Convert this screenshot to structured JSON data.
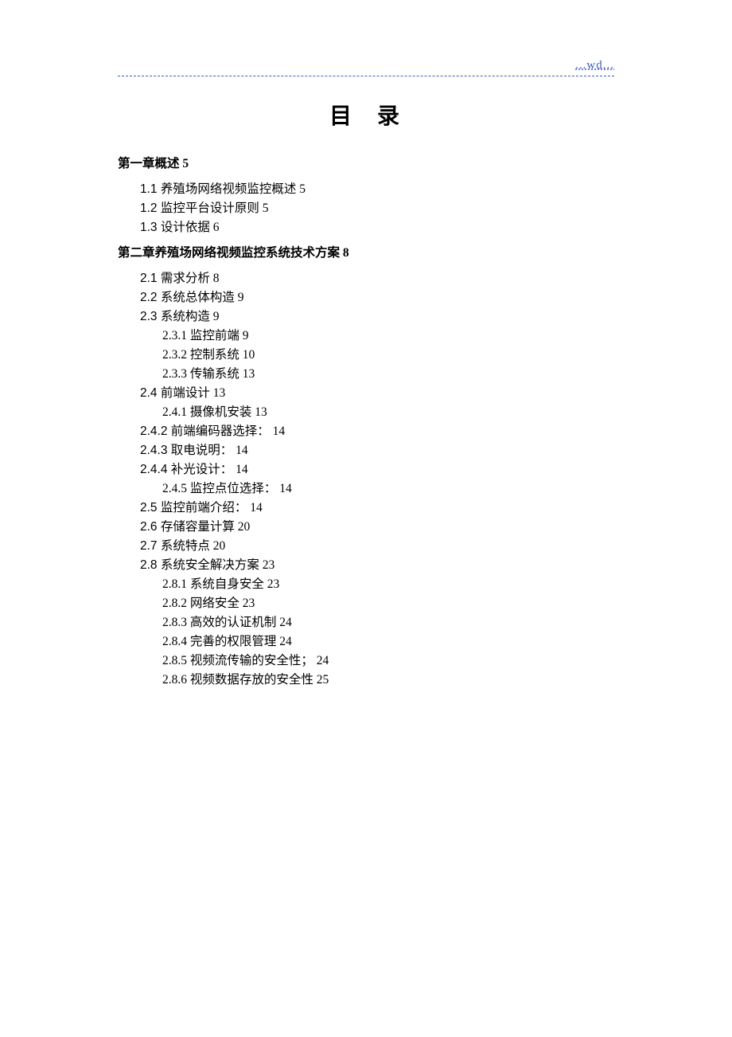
{
  "header": "...wd...",
  "title_part1": "目",
  "title_part2": "录",
  "toc": [
    {
      "level": 1,
      "text": "第一章概述",
      "page": "5"
    },
    {
      "level": 2,
      "text": "1.1 养殖场网络视频监控概述",
      "page": "5"
    },
    {
      "level": 2,
      "text": "1.2 监控平台设计原则",
      "page": "5"
    },
    {
      "level": 2,
      "text": "1.3 设计依据",
      "page": "6"
    },
    {
      "level": 1,
      "text": "第二章养殖场网络视频监控系统技术方案",
      "page": "8"
    },
    {
      "level": 2,
      "text": "2.1 需求分析",
      "page": "8"
    },
    {
      "level": 2,
      "text": "2.2 系统总体构造",
      "page": "9"
    },
    {
      "level": 2,
      "text": "2.3 系统构造",
      "page": "9"
    },
    {
      "level": 3,
      "text": "2.3.1 监控前端",
      "page": "9"
    },
    {
      "level": 3,
      "text": "2.3.2 控制系统",
      "page": "10"
    },
    {
      "level": 3,
      "text": "2.3.3 传输系统",
      "page": "13"
    },
    {
      "level": 2,
      "text": "2.4 前端设计",
      "page": "13"
    },
    {
      "level": 3,
      "text": "2.4.1 摄像机安装",
      "page": "13"
    },
    {
      "level": "2-alt",
      "text": "2.4.2 前端编码器选择：",
      "page": "14"
    },
    {
      "level": "2-alt",
      "text": "2.4.3 取电说明：",
      "page": "14"
    },
    {
      "level": "2-alt",
      "text": "2.4.4 补光设计：",
      "page": "14"
    },
    {
      "level": 3,
      "text": "2.4.5 监控点位选择：",
      "page": "14"
    },
    {
      "level": 2,
      "text": "2.5 监控前端介绍：",
      "page": "14"
    },
    {
      "level": 2,
      "text": "2.6 存储容量计算",
      "page": "20"
    },
    {
      "level": 2,
      "text": "2.7 系统特点",
      "page": "20"
    },
    {
      "level": 2,
      "text": "2.8 系统安全解决方案",
      "page": "23"
    },
    {
      "level": 3,
      "text": "2.8.1 系统自身安全",
      "page": "23"
    },
    {
      "level": 3,
      "text": "2.8.2 网络安全",
      "page": "23"
    },
    {
      "level": 3,
      "text": "2.8.3 高效的认证机制",
      "page": "24"
    },
    {
      "level": 3,
      "text": "2.8.4 完善的权限管理",
      "page": "24"
    },
    {
      "level": 3,
      "text": "2.8.5 视频流传输的安全性；",
      "page": "24"
    },
    {
      "level": 3,
      "text": "2.8.6 视频数据存放的安全性",
      "page": "25"
    }
  ]
}
